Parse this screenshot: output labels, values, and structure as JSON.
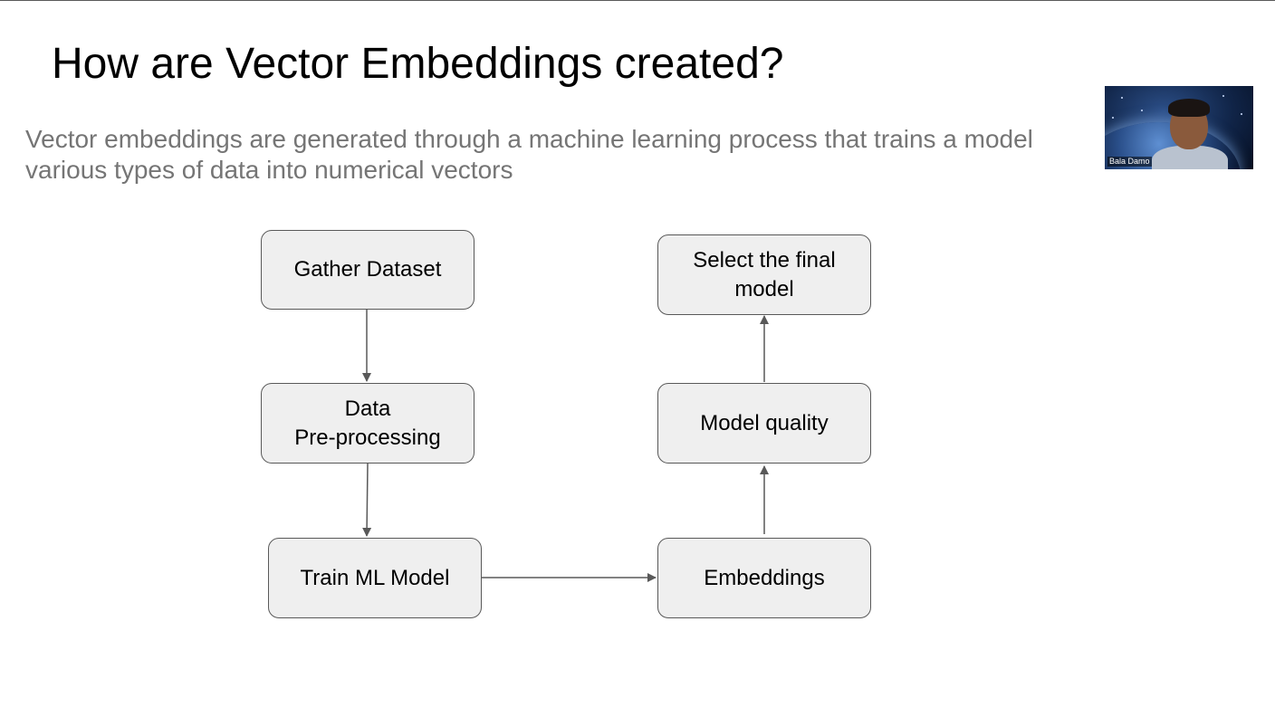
{
  "slide": {
    "title": "How are Vector Embeddings created?",
    "subtitle_lines": [
      "Vector embeddings are generated through a machine learning process that trains a model",
      "various types of data into numerical vectors"
    ]
  },
  "webcam": {
    "participant_name": "Bala Damo"
  },
  "diagram": {
    "boxes": {
      "gather_dataset": {
        "lines": [
          "Gather Dataset"
        ]
      },
      "data_preprocessing": {
        "lines": [
          "Data",
          "Pre-processing"
        ]
      },
      "train_ml_model": {
        "lines": [
          "Train ML Model"
        ]
      },
      "embeddings": {
        "lines": [
          "Embeddings"
        ]
      },
      "model_quality": {
        "lines": [
          "Model quality"
        ]
      },
      "select_final_model": {
        "lines": [
          "Select the final",
          "model"
        ]
      }
    },
    "flow": [
      [
        "gather_dataset",
        "data_preprocessing"
      ],
      [
        "data_preprocessing",
        "train_ml_model"
      ],
      [
        "train_ml_model",
        "embeddings"
      ],
      [
        "embeddings",
        "model_quality"
      ],
      [
        "model_quality",
        "select_final_model"
      ]
    ]
  },
  "colors": {
    "box_fill": "#efefef",
    "box_border": "#595959",
    "arrow": "#595959",
    "subtitle_text": "#757575",
    "title_text": "#000000"
  }
}
